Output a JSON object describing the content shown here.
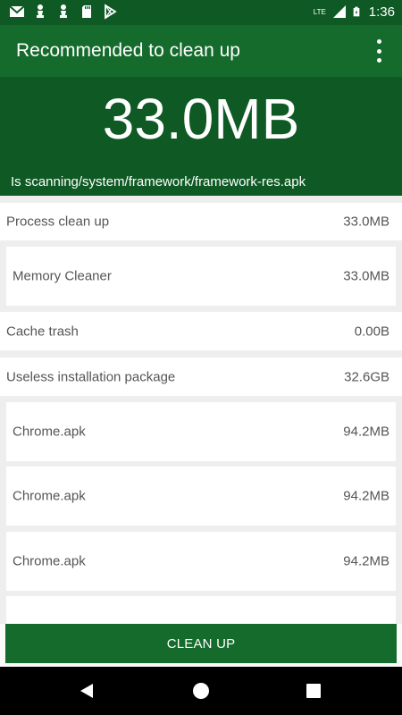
{
  "status_bar": {
    "time": "1:36",
    "network_label": "LTE",
    "icons": [
      "gmail-icon",
      "chess-pawn-icon",
      "chess-pawn-icon",
      "sd-card-icon",
      "play-store-icon",
      "signal-icon",
      "battery-charging-icon"
    ]
  },
  "appbar": {
    "title": "Recommended to clean up",
    "menu_icon": "more-vert-icon"
  },
  "hero": {
    "total_size": "33.0MB",
    "scan_path": "Is scanning/system/framework/framework-res.apk"
  },
  "rows": [
    {
      "label": "Process clean up",
      "value": "33.0MB"
    },
    {
      "label": "Memory Cleaner",
      "value": "33.0MB"
    },
    {
      "label": "Cache trash",
      "value": "0.00B"
    },
    {
      "label": "Useless installation package",
      "value": "32.6GB"
    },
    {
      "label": "Chrome.apk",
      "value": "94.2MB"
    },
    {
      "label": "Chrome.apk",
      "value": "94.2MB"
    },
    {
      "label": "Chrome.apk",
      "value": "94.2MB"
    }
  ],
  "button": {
    "label": "CLEAN UP"
  },
  "nav": {
    "icons": [
      "back-icon",
      "home-icon",
      "recents-icon"
    ]
  },
  "colors": {
    "primary": "#146b2c",
    "primary_dark": "#0f5a24",
    "background": "#eeeeee"
  }
}
